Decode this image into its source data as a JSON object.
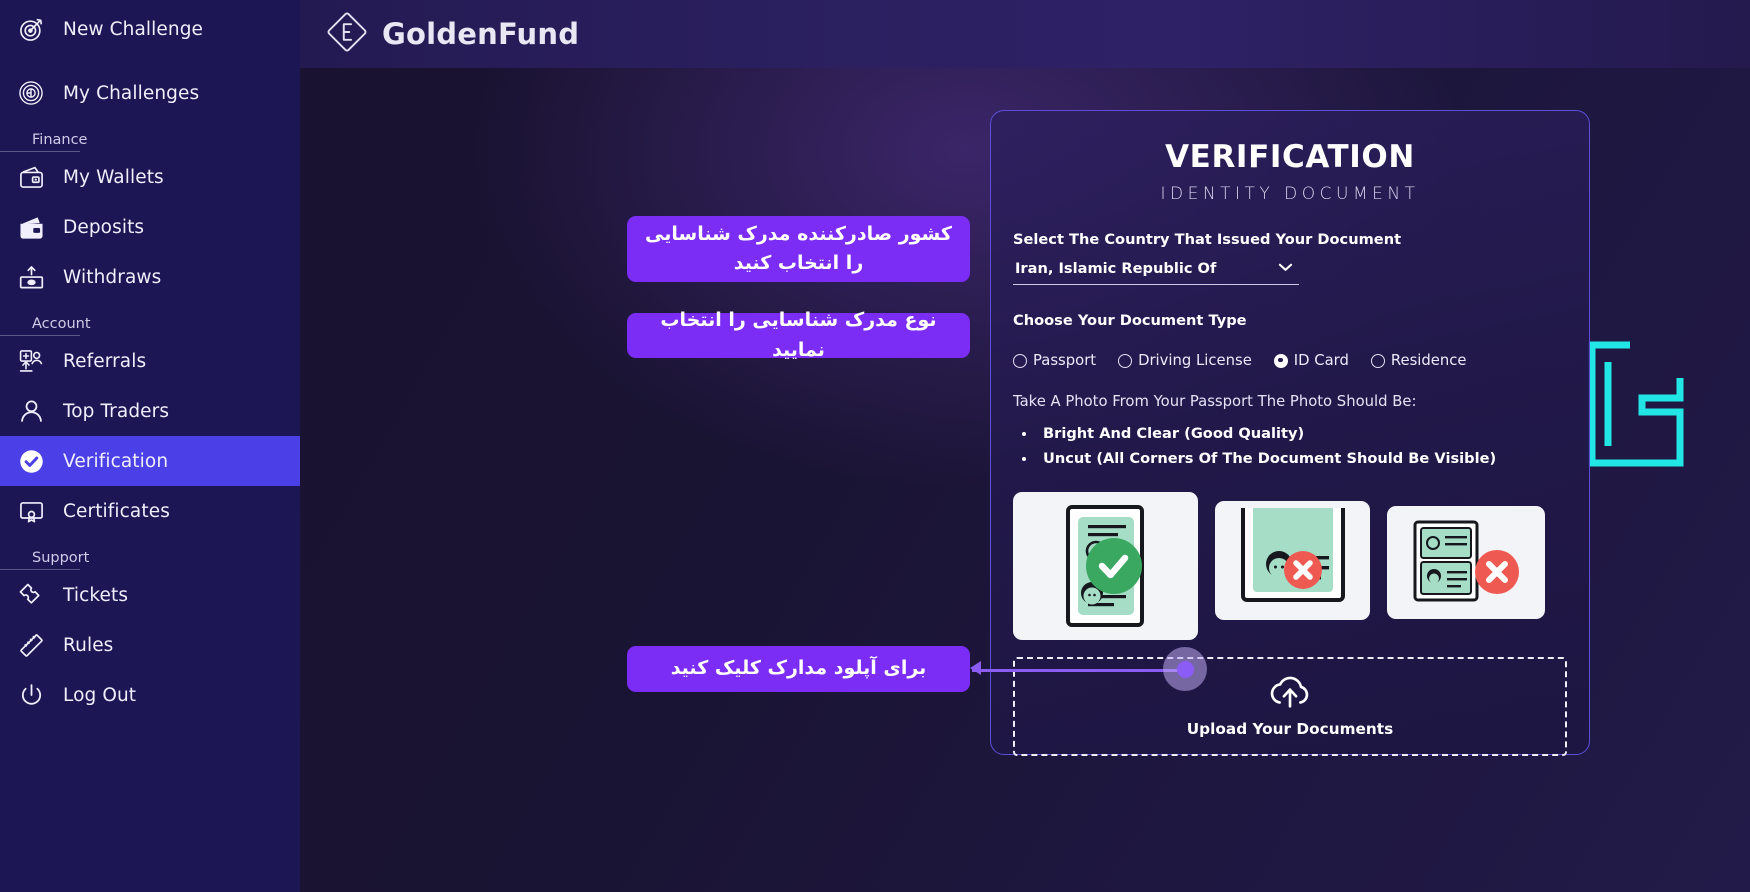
{
  "brand": {
    "name": "GoldenFund",
    "logo_icon": "diamond-logo-icon"
  },
  "breadcrumb": {
    "parent": "Account",
    "separator": "|",
    "current": "Verification"
  },
  "sidebar": {
    "items": [
      {
        "type": "item",
        "label": "New Challenge",
        "icon": "target-icon",
        "active": false
      },
      {
        "type": "item",
        "label": "My Challenges",
        "icon": "maze-icon",
        "active": false
      },
      {
        "type": "section",
        "label": "Finance"
      },
      {
        "type": "item",
        "label": "My Wallets",
        "icon": "wallet-icon",
        "active": false
      },
      {
        "type": "item",
        "label": "Deposits",
        "icon": "deposit-icon",
        "active": false
      },
      {
        "type": "item",
        "label": "Withdraws",
        "icon": "withdraw-icon",
        "active": false
      },
      {
        "type": "section",
        "label": "Account"
      },
      {
        "type": "item",
        "label": "Referrals",
        "icon": "referrals-icon",
        "active": false
      },
      {
        "type": "item",
        "label": "Top Traders",
        "icon": "user-icon",
        "active": false
      },
      {
        "type": "item",
        "label": "Verification",
        "icon": "check-badge-icon",
        "active": true
      },
      {
        "type": "item",
        "label": "Certificates",
        "icon": "certificate-icon",
        "active": false
      },
      {
        "type": "section",
        "label": "Support"
      },
      {
        "type": "item",
        "label": "Tickets",
        "icon": "ticket-icon",
        "active": false
      },
      {
        "type": "item",
        "label": "Rules",
        "icon": "ruler-icon",
        "active": false
      },
      {
        "type": "item",
        "label": "Log Out",
        "icon": "power-icon",
        "active": false
      }
    ]
  },
  "card": {
    "title": "VERIFICATION",
    "subtitle": "IDENTITY DOCUMENT",
    "country_label": "Select The Country That Issued Your Document",
    "country_value": "Iran, Islamic Republic Of",
    "doc_type_label": "Choose Your Document Type",
    "doc_types": [
      {
        "label": "Passport",
        "selected": false
      },
      {
        "label": "Driving License",
        "selected": false
      },
      {
        "label": "ID Card",
        "selected": true
      },
      {
        "label": "Residence",
        "selected": false
      }
    ],
    "photo_instruction": "Take A Photo From Your Passport The Photo Should Be:",
    "photo_rules": [
      "Bright And Clear (Good Quality)",
      "Uncut (All Corners Of The Document Should Be Visible)"
    ],
    "samples": [
      {
        "name": "sample-good",
        "status": "good",
        "icon": "green-check-icon"
      },
      {
        "name": "sample-cropped",
        "status": "bad",
        "icon": "red-x-icon"
      },
      {
        "name": "sample-blurry",
        "status": "bad",
        "icon": "red-x-icon"
      }
    ],
    "upload_label": "Upload Your Documents",
    "upload_icon": "cloud-upload-icon"
  },
  "callouts": {
    "country": "کشور صادرکننده مدرک شناسایی را انتخاب کنید",
    "doc_type": "نوع مدرک شناسایی را انتخاب نمایید",
    "upload": "برای آپلود مدارک کلیک کنید"
  },
  "colors": {
    "sidebar_bg": "#1d1655",
    "active_nav": "#4b40e8",
    "callout_purple": "#7b2cf5",
    "card_border": "#5b4fd8",
    "watermark_cyan": "#22e6e6",
    "good_green": "#3aa860",
    "bad_red": "#ee5a52"
  }
}
